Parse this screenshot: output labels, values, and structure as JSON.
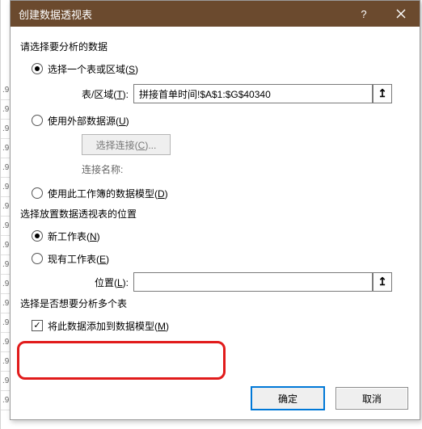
{
  "background": {
    "row_labels": [
      ".9",
      ".9",
      ".9",
      ".9",
      ".9",
      ".9",
      ".9",
      ".9",
      ".9",
      ".9",
      ".9",
      ".9",
      ".9",
      ".9",
      ".9",
      ".9",
      ".9"
    ]
  },
  "titlebar": {
    "title": "创建数据透视表"
  },
  "section1": {
    "heading": "请选择要分析的数据",
    "opt_table": {
      "prefix": "选择一个表或区域(",
      "accel": "S",
      "suffix": ")"
    },
    "range_label": {
      "prefix": "表/区域(",
      "accel": "T",
      "suffix": "):"
    },
    "range_value": "拼接首单时间!$A$1:$G$40340",
    "opt_external": {
      "prefix": "使用外部数据源(",
      "accel": "U",
      "suffix": ")"
    },
    "conn_button": {
      "prefix": "选择连接(",
      "accel": "C",
      "suffix": ")..."
    },
    "conn_name_label": "连接名称:",
    "opt_datamodel": {
      "prefix": "使用此工作簿的数据模型(",
      "accel": "D",
      "suffix": ")"
    }
  },
  "section2": {
    "heading": "选择放置数据透视表的位置",
    "opt_new": {
      "prefix": "新工作表(",
      "accel": "N",
      "suffix": ")"
    },
    "opt_existing": {
      "prefix": "现有工作表(",
      "accel": "E",
      "suffix": ")"
    },
    "loc_label": {
      "prefix": "位置(",
      "accel": "L",
      "suffix": "):"
    },
    "loc_value": ""
  },
  "section3": {
    "heading": "选择是否想要分析多个表",
    "opt_add": {
      "prefix": "将此数据添加到数据模型(",
      "accel": "M",
      "suffix": ")"
    }
  },
  "buttons": {
    "ok": "确定",
    "cancel": "取消"
  },
  "icons": {
    "help": "?",
    "close": "✕",
    "range_picker": "↥"
  }
}
